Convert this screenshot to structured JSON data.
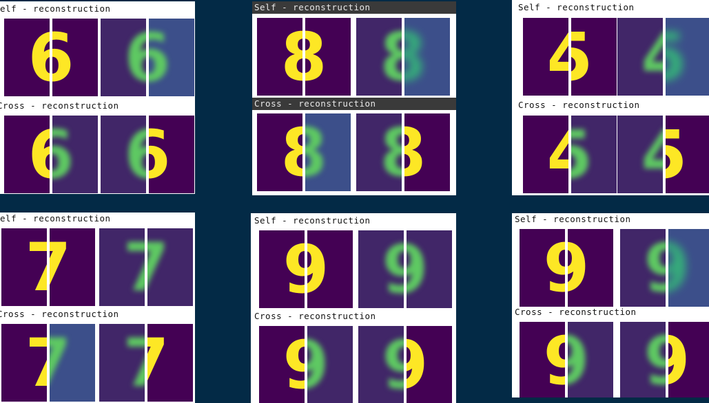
{
  "labels": {
    "self": "Self - reconstruction",
    "cross": "Cross - reconstruction"
  },
  "panels": [
    {
      "id": "p1",
      "digits": [
        {
          "left": "6",
          "right": "6"
        },
        {
          "left": "6",
          "right": "6"
        },
        {
          "left": "6",
          "right": "6"
        },
        {
          "left": "6",
          "right": "6"
        }
      ]
    },
    {
      "id": "p2",
      "digits": [
        {
          "left": "8",
          "right": "8"
        },
        {
          "left": "8",
          "right": "8"
        },
        {
          "left": "8",
          "right": "8"
        },
        {
          "left": "8",
          "right": "8"
        }
      ]
    },
    {
      "id": "p3",
      "digits": [
        {
          "left": "4",
          "right": "5"
        },
        {
          "left": "4",
          "right": "5"
        },
        {
          "left": "4",
          "right": "5"
        },
        {
          "left": "4",
          "right": "5"
        }
      ]
    },
    {
      "id": "p4",
      "digits": [
        {
          "left": "7",
          "right": "7"
        },
        {
          "left": "7",
          "right": "7"
        },
        {
          "left": "7",
          "right": "7"
        },
        {
          "left": "7",
          "right": "7"
        }
      ]
    },
    {
      "id": "p5",
      "digits": [
        {
          "left": "9",
          "right": "9"
        },
        {
          "left": "9",
          "right": "9"
        },
        {
          "left": "9",
          "right": "9"
        },
        {
          "left": "9",
          "right": "9"
        }
      ]
    },
    {
      "id": "p6",
      "digits": [
        {
          "left": "9",
          "right": "9"
        },
        {
          "left": "9",
          "right": "9"
        },
        {
          "left": "9",
          "right": "9"
        },
        {
          "left": "9",
          "right": "9"
        }
      ]
    }
  ],
  "colors": {
    "background": "#032a46",
    "viridis_dark": "#440154",
    "viridis_mid": "#3c4f8a",
    "viridis_yellow": "#fde725",
    "viridis_green": "#5ec962"
  }
}
